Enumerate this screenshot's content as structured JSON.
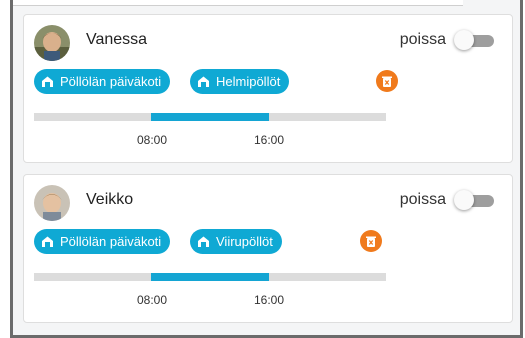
{
  "children": [
    {
      "name": "Vanessa",
      "absent_label": "poissa",
      "absent_on": false,
      "groups": [
        "Pöllölän päiväkoti",
        "Helmipöllöt"
      ],
      "times": {
        "start": "08:00",
        "end": "16:00"
      },
      "schedule_fraction": {
        "start": 0.333,
        "end": 0.667
      },
      "colors": {
        "chip": "#0fa9d4",
        "bar_fill": "#14a5d3",
        "trash": "#f07a1c"
      },
      "icons": {
        "avatar": "child-avatar",
        "chip": "home-icon",
        "delete": "trash-icon"
      }
    },
    {
      "name": "Veikko",
      "absent_label": "poissa",
      "absent_on": false,
      "groups": [
        "Pöllölän päiväkoti",
        "Viirupöllöt"
      ],
      "times": {
        "start": "08:00",
        "end": "16:00"
      },
      "schedule_fraction": {
        "start": 0.333,
        "end": 0.667
      },
      "colors": {
        "chip": "#0fa9d4",
        "bar_fill": "#14a5d3",
        "trash": "#f07a1c"
      },
      "icons": {
        "avatar": "child-avatar",
        "chip": "home-icon",
        "delete": "trash-icon"
      }
    }
  ]
}
